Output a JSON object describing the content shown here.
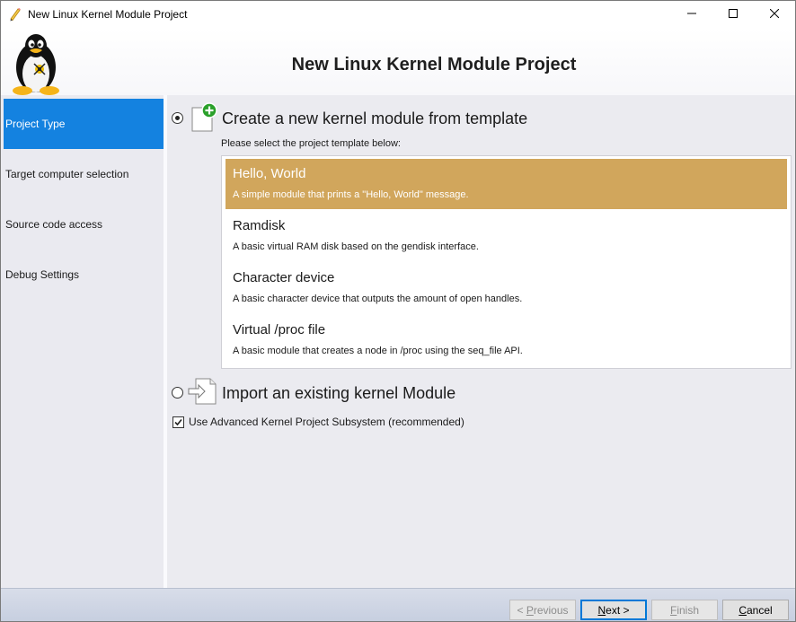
{
  "window": {
    "title": "New Linux Kernel Module Project",
    "app_icon": "pencil-icon",
    "controls": [
      "minimize-icon",
      "maximize-icon",
      "close-icon"
    ]
  },
  "header": {
    "title": "New Linux Kernel Module Project",
    "logo": "tux-penguin-logo"
  },
  "sidebar": {
    "items": [
      {
        "label": "Project Type",
        "active": true
      },
      {
        "label": "Target computer selection",
        "active": false
      },
      {
        "label": "Source code access",
        "active": false
      },
      {
        "label": "Debug Settings",
        "active": false
      }
    ]
  },
  "main": {
    "create_option": {
      "label": "Create a new kernel module from template",
      "selected": true,
      "icon": "new-document-plus-icon"
    },
    "template_hint": "Please select the project template below:",
    "templates": [
      {
        "name": "Hello, World",
        "description": "A simple module that prints a \"Hello, World\" message.",
        "selected": true
      },
      {
        "name": "Ramdisk",
        "description": "A basic virtual RAM disk based on the gendisk interface.",
        "selected": false
      },
      {
        "name": "Character device",
        "description": "A basic character device that outputs the amount of open handles.",
        "selected": false
      },
      {
        "name": "Virtual /proc file",
        "description": "A basic module that creates a node in /proc using the seq_file API.",
        "selected": false
      }
    ],
    "import_option": {
      "label": "Import an existing kernel Module",
      "selected": false,
      "icon": "import-document-icon"
    },
    "advanced_checkbox": {
      "label": "Use Advanced Kernel Project Subsystem (recommended)",
      "checked": true
    }
  },
  "footer": {
    "previous": {
      "prefix": "< ",
      "accel": "P",
      "rest": "revious",
      "enabled": false
    },
    "next": {
      "accel": "N",
      "rest": "ext >",
      "enabled": true
    },
    "finish": {
      "accel": "F",
      "rest": "inish",
      "enabled": false
    },
    "cancel": {
      "accel": "C",
      "rest": "ancel",
      "enabled": true
    }
  },
  "colors": {
    "sidebar_active": "#1482e0",
    "template_selected": "#d1a65c",
    "content_bg": "#ebebf0"
  }
}
